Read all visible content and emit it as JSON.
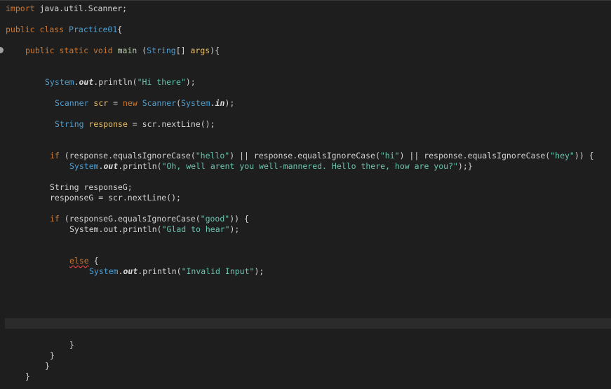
{
  "editor": {
    "language": "java",
    "lines": [
      {
        "id": "l1",
        "tokens": [
          [
            "kw",
            "import"
          ],
          [
            "plain",
            " java.util.Scanner;"
          ]
        ]
      },
      {
        "id": "l2",
        "tokens": [
          [
            "kw",
            "public"
          ],
          [
            "plain",
            " "
          ],
          [
            "kw",
            "class"
          ],
          [
            "plain",
            " "
          ],
          [
            "cls",
            "Practice01"
          ],
          [
            "plain",
            "{"
          ]
        ]
      },
      {
        "id": "l3",
        "tokens": [
          [
            "kw",
            "public"
          ],
          [
            "plain",
            " "
          ],
          [
            "kw",
            "static"
          ],
          [
            "plain",
            " "
          ],
          [
            "kw",
            "void"
          ],
          [
            "plain",
            " "
          ],
          [
            "mth",
            "main"
          ],
          [
            "plain",
            " ("
          ],
          [
            "cls",
            "String"
          ],
          [
            "plain",
            "[] "
          ],
          [
            "var",
            "args"
          ],
          [
            "plain",
            "){"
          ]
        ]
      },
      {
        "id": "l4",
        "tokens": [
          [
            "cls",
            "System"
          ],
          [
            "plain",
            "."
          ],
          [
            "fld",
            "out"
          ],
          [
            "plain",
            "."
          ],
          [
            "plain",
            "println("
          ],
          [
            "str",
            "\"Hi there\""
          ],
          [
            "plain",
            ");"
          ]
        ]
      },
      {
        "id": "l5",
        "tokens": [
          [
            "cls",
            "Scanner"
          ],
          [
            "plain",
            " "
          ],
          [
            "var",
            "scr"
          ],
          [
            "plain",
            " = "
          ],
          [
            "kw",
            "new"
          ],
          [
            "plain",
            " "
          ],
          [
            "cls",
            "Scanner"
          ],
          [
            "plain",
            "("
          ],
          [
            "cls",
            "System"
          ],
          [
            "plain",
            "."
          ],
          [
            "fld",
            "in"
          ],
          [
            "plain",
            ");"
          ]
        ]
      },
      {
        "id": "l6",
        "tokens": [
          [
            "cls",
            "String"
          ],
          [
            "plain",
            " "
          ],
          [
            "var",
            "response"
          ],
          [
            "plain",
            " = scr."
          ],
          [
            "plain",
            "nextLine"
          ],
          [
            "plain",
            "();"
          ]
        ]
      },
      {
        "id": "l7",
        "tokens": [
          [
            "kw",
            "if"
          ],
          [
            "plain",
            " (response."
          ],
          [
            "plain",
            "equalsIgnoreCase"
          ],
          [
            "plain",
            "("
          ],
          [
            "str",
            "\"hello\""
          ],
          [
            "plain",
            ") || response."
          ],
          [
            "plain",
            "equalsIgnoreCase"
          ],
          [
            "plain",
            "("
          ],
          [
            "str",
            "\"hi\""
          ],
          [
            "plain",
            ") || response."
          ],
          [
            "plain",
            "equalsIgnoreCase"
          ],
          [
            "plain",
            "("
          ],
          [
            "str",
            "\"hey\""
          ],
          [
            "plain",
            ")) {"
          ]
        ]
      },
      {
        "id": "l8",
        "tokens": [
          [
            "cls",
            "System"
          ],
          [
            "plain",
            "."
          ],
          [
            "fld",
            "out"
          ],
          [
            "plain",
            ".println("
          ],
          [
            "str",
            "\"Oh, well arent you well-mannered. Hello there, how are you?\""
          ],
          [
            "plain",
            ");}"
          ]
        ]
      },
      {
        "id": "l9",
        "tokens": [
          [
            "plain",
            "String responseG;"
          ]
        ]
      },
      {
        "id": "l10",
        "tokens": [
          [
            "plain",
            "responseG = scr.nextLine();"
          ]
        ]
      },
      {
        "id": "l11",
        "tokens": [
          [
            "kw",
            "if"
          ],
          [
            "plain",
            " (responseG.equalsIgnoreCase("
          ],
          [
            "str",
            "\"good\""
          ],
          [
            "plain",
            ")) {"
          ]
        ]
      },
      {
        "id": "l12",
        "tokens": [
          [
            "plain",
            "System.out.println("
          ],
          [
            "str",
            "\"Glad to hear\""
          ],
          [
            "plain",
            ");"
          ]
        ]
      },
      {
        "id": "l13",
        "tokens": [
          [
            "err",
            "else"
          ],
          [
            "plain",
            " {"
          ]
        ]
      },
      {
        "id": "l14",
        "tokens": [
          [
            "cls",
            "System"
          ],
          [
            "plain",
            "."
          ],
          [
            "fld",
            "out"
          ],
          [
            "plain",
            ".println("
          ],
          [
            "str",
            "\"Invalid Input\""
          ],
          [
            "plain",
            ");"
          ]
        ]
      },
      {
        "id": "l15",
        "tokens": [
          [
            "plain",
            "}"
          ]
        ]
      },
      {
        "id": "l16",
        "tokens": [
          [
            "plain",
            "}"
          ]
        ]
      },
      {
        "id": "l17",
        "tokens": [
          [
            "plain",
            "}"
          ]
        ]
      },
      {
        "id": "l18",
        "tokens": [
          [
            "plain",
            "}"
          ]
        ]
      }
    ]
  }
}
